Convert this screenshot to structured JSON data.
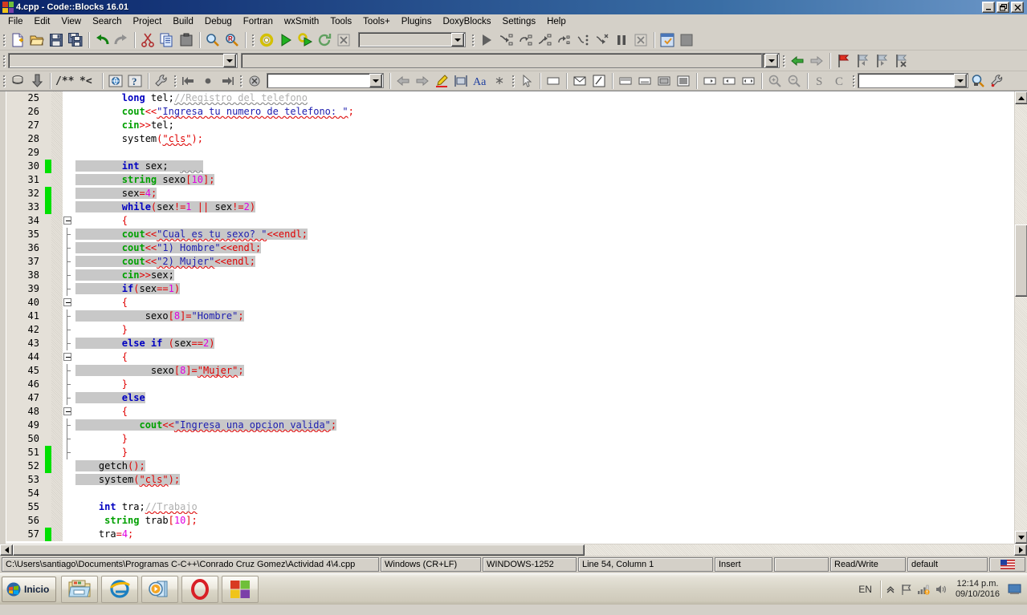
{
  "window": {
    "title": "4.cpp - Code::Blocks 16.01",
    "icon": "codeblocks-logo-icon",
    "minimize": "_",
    "restore": "❐",
    "close": "✕"
  },
  "menubar": {
    "items": [
      {
        "label": "File"
      },
      {
        "label": "Edit"
      },
      {
        "label": "View"
      },
      {
        "label": "Search"
      },
      {
        "label": "Project"
      },
      {
        "label": "Build"
      },
      {
        "label": "Debug"
      },
      {
        "label": "Fortran"
      },
      {
        "label": "wxSmith"
      },
      {
        "label": "Tools"
      },
      {
        "label": "Tools+"
      },
      {
        "label": "Plugins"
      },
      {
        "label": "DoxyBlocks"
      },
      {
        "label": "Settings"
      },
      {
        "label": "Help"
      }
    ]
  },
  "toolbar_main": {
    "buttons": [
      "new-file-icon",
      "open-file-icon",
      "save-icon",
      "save-all-icon",
      "undo-icon",
      "redo-icon",
      "cut-icon",
      "copy-icon",
      "paste-icon",
      "find-icon",
      "replace-icon"
    ]
  },
  "toolbar_compiler": {
    "buttons": [
      "build-icon",
      "run-icon",
      "build-and-run-icon",
      "rebuild-icon",
      "abort-icon"
    ],
    "target_combo": {
      "value": "",
      "placeholder": ""
    }
  },
  "toolbar_debug": {
    "buttons": [
      "debug-continue-icon",
      "step-into-icon",
      "step-over-icon",
      "step-out-icon",
      "next-instruction-icon",
      "step-into-instruction-icon",
      "run-to-cursor-icon",
      "break-debugger-icon",
      "stop-debugger-icon",
      "debugging-windows-icon",
      "various-info-icon"
    ]
  },
  "toolbar_row2": {
    "search_field": {
      "value": "",
      "placeholder": ""
    },
    "scope_field": {
      "value": "",
      "placeholder": ""
    },
    "buttons": [
      "nav-back-icon",
      "nav-forward-icon",
      "toggle-bookmark-icon",
      "previous-bookmark-icon",
      "next-bookmark-icon",
      "clear-bookmarks-icon"
    ]
  },
  "toolbar_doxyblocks": {
    "buttons": [
      "doxywizard-icon",
      "extract-documentation-icon",
      "block-comment-icon",
      "line-comment-icon",
      "run-html-icon",
      "run-chm-icon",
      "doxyblocks-settings-icon"
    ]
  },
  "toolbar_fortran": {
    "buttons": [
      "jump-back-icon",
      "jump-home-icon",
      "jump-forward-icon"
    ]
  },
  "toolbar_wxsmith": {
    "combo": {
      "value": "",
      "placeholder": ""
    },
    "buttons": [
      "close-designer-icon",
      "nav-prev-icon",
      "nav-next-icon",
      "highlight-icon",
      "align-icon",
      "font-icon",
      "star-icon",
      "pointer-icon",
      "panel-icon",
      "envelope-icon",
      "code-icon",
      "layout-top-icon",
      "layout-bottom-icon",
      "layout-center-icon",
      "layout-fill-icon",
      "expand-right-icon",
      "expand-left-icon",
      "expand-both-icon"
    ]
  },
  "toolbar_zoom": {
    "buttons": [
      "zoom-in-icon",
      "zoom-out-icon",
      "source-s-icon",
      "source-c-icon"
    ],
    "symbol_combo": {
      "value": "",
      "placeholder": ""
    },
    "find-symbol": "find-symbol-icon",
    "settings": "wrench-icon"
  },
  "editor": {
    "first_visible_line": 25,
    "lines": [
      {
        "n": 25,
        "fold": "none",
        "changed": false,
        "sel": false,
        "tokens": [
          {
            "t": "        ",
            "c": "pln"
          },
          {
            "t": "long",
            "c": "kw"
          },
          {
            "t": " tel;",
            "c": "pln"
          },
          {
            "t": "//Registro del telefono",
            "c": "cmt sqg"
          }
        ]
      },
      {
        "n": 26,
        "fold": "none",
        "changed": false,
        "sel": false,
        "tokens": [
          {
            "t": "        ",
            "c": "pln"
          },
          {
            "t": "cout",
            "c": "typ"
          },
          {
            "t": "<<",
            "c": "op"
          },
          {
            "t": "\"Ingresa tu numero de telefono: \"",
            "c": "strb sq"
          },
          {
            "t": ";",
            "c": "op"
          }
        ]
      },
      {
        "n": 27,
        "fold": "none",
        "changed": false,
        "sel": false,
        "tokens": [
          {
            "t": "        ",
            "c": "pln"
          },
          {
            "t": "cin",
            "c": "typ"
          },
          {
            "t": ">>",
            "c": "op"
          },
          {
            "t": "tel;",
            "c": "pln"
          }
        ]
      },
      {
        "n": 28,
        "fold": "none",
        "changed": false,
        "sel": false,
        "tokens": [
          {
            "t": "        system",
            "c": "pln"
          },
          {
            "t": "(",
            "c": "op"
          },
          {
            "t": "\"cls\"",
            "c": "str sq"
          },
          {
            "t": ");",
            "c": "op"
          }
        ]
      },
      {
        "n": 29,
        "fold": "none",
        "changed": false,
        "sel": false,
        "tokens": []
      },
      {
        "n": 30,
        "fold": "none",
        "changed": true,
        "sel": true,
        "tokens": [
          {
            "t": "        ",
            "c": "pln"
          },
          {
            "t": "int",
            "c": "kw"
          },
          {
            "t": " sex;  ",
            "c": "pln"
          },
          {
            "t": "    ",
            "c": "pln sqg"
          }
        ]
      },
      {
        "n": 31,
        "fold": "none",
        "changed": false,
        "sel": true,
        "tokens": [
          {
            "t": "        ",
            "c": "pln"
          },
          {
            "t": "string",
            "c": "typ"
          },
          {
            "t": " sexo",
            "c": "pln"
          },
          {
            "t": "[",
            "c": "op"
          },
          {
            "t": "10",
            "c": "num"
          },
          {
            "t": "]",
            "c": "op"
          },
          {
            "t": ";",
            "c": "op"
          }
        ]
      },
      {
        "n": 32,
        "fold": "none",
        "changed": true,
        "sel": true,
        "tokens": [
          {
            "t": "        sex",
            "c": "pln"
          },
          {
            "t": "=",
            "c": "op"
          },
          {
            "t": "4",
            "c": "num"
          },
          {
            "t": ";",
            "c": "op"
          }
        ]
      },
      {
        "n": 33,
        "fold": "none",
        "changed": true,
        "sel": true,
        "tokens": [
          {
            "t": "        ",
            "c": "pln"
          },
          {
            "t": "while",
            "c": "kw"
          },
          {
            "t": "(",
            "c": "op"
          },
          {
            "t": "sex",
            "c": "pln"
          },
          {
            "t": "!=",
            "c": "op"
          },
          {
            "t": "1",
            "c": "num"
          },
          {
            "t": " ",
            "c": "pln"
          },
          {
            "t": "||",
            "c": "op"
          },
          {
            "t": " sex",
            "c": "pln"
          },
          {
            "t": "!=",
            "c": "op"
          },
          {
            "t": "2",
            "c": "num"
          },
          {
            "t": ")",
            "c": "op"
          }
        ]
      },
      {
        "n": 34,
        "fold": "box",
        "changed": false,
        "sel": false,
        "tokens": [
          {
            "t": "        ",
            "c": "pln"
          },
          {
            "t": "{",
            "c": "op"
          }
        ]
      },
      {
        "n": 35,
        "fold": "line",
        "changed": false,
        "sel": true,
        "tokens": [
          {
            "t": "        ",
            "c": "pln"
          },
          {
            "t": "cout",
            "c": "typ"
          },
          {
            "t": "<<",
            "c": "op"
          },
          {
            "t": "\"Cual es tu sexo? \"",
            "c": "strb sq"
          },
          {
            "t": "<<",
            "c": "op"
          },
          {
            "t": "endl",
            "c": "str"
          },
          {
            "t": ";",
            "c": "op"
          }
        ]
      },
      {
        "n": 36,
        "fold": "line",
        "changed": false,
        "sel": true,
        "tokens": [
          {
            "t": "        ",
            "c": "pln"
          },
          {
            "t": "cout",
            "c": "typ"
          },
          {
            "t": "<<",
            "c": "op"
          },
          {
            "t": "\"1) Hombre\"",
            "c": "strb"
          },
          {
            "t": "<<",
            "c": "op"
          },
          {
            "t": "endl",
            "c": "str"
          },
          {
            "t": ";",
            "c": "op"
          }
        ]
      },
      {
        "n": 37,
        "fold": "line",
        "changed": false,
        "sel": true,
        "tokens": [
          {
            "t": "        ",
            "c": "pln"
          },
          {
            "t": "cout",
            "c": "typ"
          },
          {
            "t": "<<",
            "c": "op"
          },
          {
            "t": "\"2) Mujer\"",
            "c": "strb sq"
          },
          {
            "t": "<<",
            "c": "op"
          },
          {
            "t": "endl",
            "c": "str"
          },
          {
            "t": ";",
            "c": "op"
          }
        ]
      },
      {
        "n": 38,
        "fold": "line",
        "changed": false,
        "sel": true,
        "tokens": [
          {
            "t": "        ",
            "c": "pln"
          },
          {
            "t": "cin",
            "c": "typ"
          },
          {
            "t": ">>",
            "c": "op"
          },
          {
            "t": "sex;",
            "c": "pln"
          }
        ]
      },
      {
        "n": 39,
        "fold": "line",
        "changed": false,
        "sel": true,
        "tokens": [
          {
            "t": "        ",
            "c": "pln"
          },
          {
            "t": "if",
            "c": "kw"
          },
          {
            "t": "(",
            "c": "op"
          },
          {
            "t": "sex",
            "c": "pln"
          },
          {
            "t": "==",
            "c": "op"
          },
          {
            "t": "1",
            "c": "num"
          },
          {
            "t": ")",
            "c": "op"
          }
        ]
      },
      {
        "n": 40,
        "fold": "box",
        "changed": false,
        "sel": false,
        "tokens": [
          {
            "t": "        ",
            "c": "pln"
          },
          {
            "t": "{",
            "c": "op"
          }
        ]
      },
      {
        "n": 41,
        "fold": "line",
        "changed": false,
        "sel": true,
        "tokens": [
          {
            "t": "            sexo",
            "c": "pln"
          },
          {
            "t": "[",
            "c": "op"
          },
          {
            "t": "8",
            "c": "num"
          },
          {
            "t": "]",
            "c": "op"
          },
          {
            "t": "=",
            "c": "op"
          },
          {
            "t": "\"Hombre\"",
            "c": "strb"
          },
          {
            "t": ";",
            "c": "op"
          }
        ]
      },
      {
        "n": 42,
        "fold": "line",
        "changed": false,
        "sel": false,
        "tokens": [
          {
            "t": "        ",
            "c": "pln"
          },
          {
            "t": "}",
            "c": "op"
          }
        ]
      },
      {
        "n": 43,
        "fold": "line",
        "changed": false,
        "sel": true,
        "tokens": [
          {
            "t": "        ",
            "c": "pln"
          },
          {
            "t": "else if",
            "c": "kw"
          },
          {
            "t": " ",
            "c": "pln"
          },
          {
            "t": "(",
            "c": "op"
          },
          {
            "t": "sex",
            "c": "pln"
          },
          {
            "t": "==",
            "c": "op"
          },
          {
            "t": "2",
            "c": "num"
          },
          {
            "t": ")",
            "c": "op"
          }
        ]
      },
      {
        "n": 44,
        "fold": "box",
        "changed": false,
        "sel": false,
        "tokens": [
          {
            "t": "        ",
            "c": "pln"
          },
          {
            "t": "{",
            "c": "op"
          }
        ]
      },
      {
        "n": 45,
        "fold": "line",
        "changed": false,
        "sel": true,
        "tokens": [
          {
            "t": "             sexo",
            "c": "pln"
          },
          {
            "t": "[",
            "c": "op"
          },
          {
            "t": "8",
            "c": "num"
          },
          {
            "t": "]",
            "c": "op"
          },
          {
            "t": "=",
            "c": "op"
          },
          {
            "t": "\"Mujer\"",
            "c": "str sq"
          },
          {
            "t": ";",
            "c": "op"
          }
        ]
      },
      {
        "n": 46,
        "fold": "line",
        "changed": false,
        "sel": false,
        "tokens": [
          {
            "t": "        ",
            "c": "pln"
          },
          {
            "t": "}",
            "c": "op"
          }
        ]
      },
      {
        "n": 47,
        "fold": "line",
        "changed": false,
        "sel": true,
        "tokens": [
          {
            "t": "        ",
            "c": "pln"
          },
          {
            "t": "else",
            "c": "kw"
          }
        ]
      },
      {
        "n": 48,
        "fold": "box",
        "changed": false,
        "sel": false,
        "tokens": [
          {
            "t": "        ",
            "c": "pln"
          },
          {
            "t": "{",
            "c": "op"
          }
        ]
      },
      {
        "n": 49,
        "fold": "line",
        "changed": false,
        "sel": true,
        "tokens": [
          {
            "t": "           ",
            "c": "pln"
          },
          {
            "t": "cout",
            "c": "typ"
          },
          {
            "t": "<<",
            "c": "op"
          },
          {
            "t": "\"Ingresa una opcion valida\"",
            "c": "strb sq"
          },
          {
            "t": ";",
            "c": "op"
          }
        ]
      },
      {
        "n": 50,
        "fold": "line",
        "changed": false,
        "sel": false,
        "tokens": [
          {
            "t": "        ",
            "c": "pln"
          },
          {
            "t": "}",
            "c": "op"
          }
        ]
      },
      {
        "n": 51,
        "fold": "line",
        "changed": true,
        "sel": false,
        "tokens": [
          {
            "t": "        ",
            "c": "pln"
          },
          {
            "t": "}",
            "c": "op"
          }
        ]
      },
      {
        "n": 52,
        "fold": "none",
        "changed": true,
        "sel": true,
        "tokens": [
          {
            "t": "    getch",
            "c": "pln"
          },
          {
            "t": "();",
            "c": "op"
          }
        ]
      },
      {
        "n": 53,
        "fold": "none",
        "changed": false,
        "sel": true,
        "tokens": [
          {
            "t": "    system",
            "c": "pln"
          },
          {
            "t": "(",
            "c": "op"
          },
          {
            "t": "\"cls\"",
            "c": "str sq"
          },
          {
            "t": ");",
            "c": "op"
          }
        ]
      },
      {
        "n": 54,
        "fold": "none",
        "changed": false,
        "sel": false,
        "tokens": []
      },
      {
        "n": 55,
        "fold": "none",
        "changed": false,
        "sel": false,
        "tokens": [
          {
            "t": "    ",
            "c": "pln"
          },
          {
            "t": "int",
            "c": "kw"
          },
          {
            "t": " tra;",
            "c": "pln"
          },
          {
            "t": "//Trabajo",
            "c": "cmt sq"
          }
        ]
      },
      {
        "n": 56,
        "fold": "none",
        "changed": false,
        "sel": false,
        "tokens": [
          {
            "t": "     ",
            "c": "pln"
          },
          {
            "t": "string",
            "c": "typ"
          },
          {
            "t": " trab",
            "c": "pln"
          },
          {
            "t": "[",
            "c": "op"
          },
          {
            "t": "10",
            "c": "num"
          },
          {
            "t": "]",
            "c": "op"
          },
          {
            "t": ";",
            "c": "op"
          }
        ]
      },
      {
        "n": 57,
        "fold": "none",
        "changed": true,
        "sel": false,
        "tokens": [
          {
            "t": "    tra",
            "c": "pln"
          },
          {
            "t": "=",
            "c": "op"
          },
          {
            "t": "4",
            "c": "num"
          },
          {
            "t": ";",
            "c": "op"
          }
        ]
      }
    ]
  },
  "statusbar": {
    "file_path": "C:\\Users\\santiago\\Documents\\Programas C-C++\\Conrado Cruz Gomez\\Actividad 4\\4.cpp",
    "line_ending": "Windows (CR+LF)",
    "encoding": "WINDOWS-1252",
    "caret": "Line 54, Column 1",
    "insert_mode": "Insert",
    "modified": "",
    "permissions": "Read/Write",
    "profile": "default",
    "keyboard_icon": "us-flag-icon"
  },
  "taskbar": {
    "start_label": "Inicio",
    "start_icon": "windows-orb-icon",
    "tasks": [
      {
        "name": "windows-explorer-icon"
      },
      {
        "name": "internet-explorer-icon"
      },
      {
        "name": "media-player-icon"
      },
      {
        "name": "opera-browser-icon"
      },
      {
        "name": "codeblocks-icon"
      }
    ],
    "tray": {
      "language": "EN",
      "show_hidden_icon": "chevron-up-icon",
      "action_center_icon": "flag-icon",
      "network_icon": "network-bars-icon",
      "volume_icon": "speaker-icon",
      "time": "12:14 p.m.",
      "date": "09/10/2016",
      "show_desktop": "show-desktop-button"
    }
  },
  "colors": {
    "title_bar": "#0a246a",
    "face": "#d4d0c8",
    "editor_bg": "#ffffff",
    "selection": "#c8c8c8",
    "change_marker": "#00e000",
    "keyword": "#0000c0",
    "type": "#00a000",
    "string": "#e00000",
    "number": "#e000e0",
    "comment": "#b0b0b0"
  }
}
